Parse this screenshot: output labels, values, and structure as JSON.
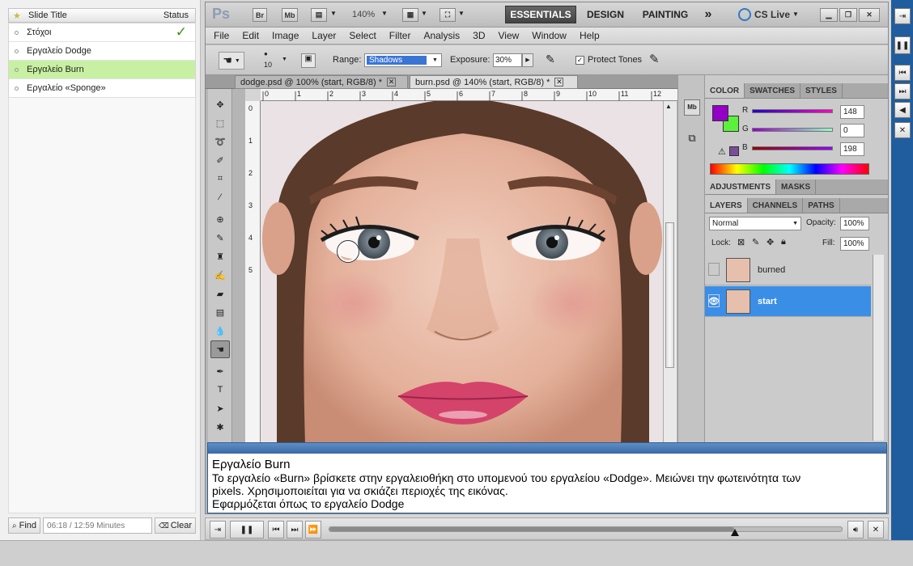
{
  "outline": {
    "title_header": "Slide Title",
    "status_header": "Status",
    "items": [
      {
        "label": "Στόχοι",
        "status": "✓"
      },
      {
        "label": "Εργαλείο Dodge",
        "status": ""
      },
      {
        "label": "Εργαλείο Burn",
        "status": ""
      },
      {
        "label": "Εργαλείο «Sponge»",
        "status": ""
      }
    ],
    "find_label": "Find",
    "time_readout": "06:18 / 12:59 Minutes",
    "clear_label": "Clear"
  },
  "photoshop": {
    "logo": "Ps",
    "zoom": "140%",
    "workspaces": [
      "ESSENTIALS",
      "DESIGN",
      "PAINTING",
      "»"
    ],
    "cs_live": "CS Live",
    "menu": [
      "File",
      "Edit",
      "Image",
      "Layer",
      "Select",
      "Filter",
      "Analysis",
      "3D",
      "View",
      "Window",
      "Help"
    ],
    "options": {
      "brush_size": "10",
      "range_label": "Range:",
      "range_value": "Shadows",
      "exposure_label": "Exposure:",
      "exposure_value": "30%",
      "protect_tones_label": "Protect Tones"
    },
    "doc_tabs": [
      {
        "label": "dodge.psd @ 100% (start, RGB/8) *",
        "active": false
      },
      {
        "label": "burn.psd @ 140% (start, RGB/8) *",
        "active": true
      }
    ],
    "ruler_h": [
      "0",
      "1",
      "2",
      "3",
      "4",
      "5",
      "6",
      "7",
      "8",
      "9",
      "10",
      "11",
      "12"
    ],
    "ruler_v": [
      "0",
      "1",
      "2",
      "3",
      "4",
      "5"
    ],
    "color_panel": {
      "tabs": [
        "COLOR",
        "SWATCHES",
        "STYLES"
      ],
      "channels": [
        {
          "name": "R",
          "value": "148"
        },
        {
          "name": "G",
          "value": "0"
        },
        {
          "name": "B",
          "value": "198"
        }
      ],
      "foreground": "#9400c6",
      "background": "#5cf03c"
    },
    "adjust_tabs": [
      "ADJUSTMENTS",
      "MASKS"
    ],
    "layers_panel": {
      "tabs": [
        "LAYERS",
        "CHANNELS",
        "PATHS"
      ],
      "blend_mode": "Normal",
      "opacity_label": "Opacity:",
      "opacity": "100%",
      "lock_label": "Lock:",
      "fill_label": "Fill:",
      "fill": "100%",
      "layers": [
        {
          "name": "burned",
          "visible": false,
          "selected": false
        },
        {
          "name": "start",
          "visible": true,
          "selected": true
        }
      ]
    }
  },
  "caption": {
    "title": "Εργαλείο Burn",
    "lines": [
      "Το εργαλείο «Burn»   βρίσκετε στην εργαλειοθήκη στο υπομενού του εργαλείου «Dodge». Μειώνει την φωτεινότητα των",
      "pixels. Χρησιμοποιείται για να σκιάζει περιοχές της εικόνας.",
      "Εφαρμόζεται όπως το εργαλείο Dodge"
    ]
  },
  "player": {
    "progress": 0.79
  }
}
